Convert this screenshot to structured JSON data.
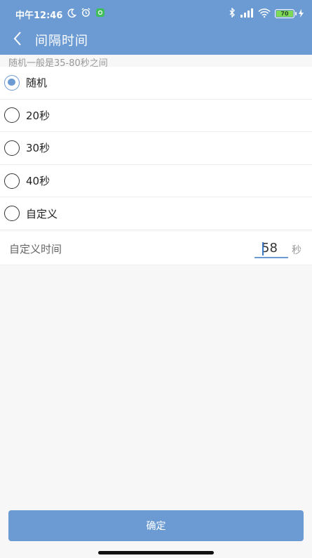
{
  "status_bar": {
    "time": "中午12:46",
    "battery_level": "70"
  },
  "nav": {
    "title": "间隔时间"
  },
  "hint": "随机一般是35-80秒之间",
  "options": [
    {
      "label": "随机",
      "selected": true
    },
    {
      "label": "20秒",
      "selected": false
    },
    {
      "label": "30秒",
      "selected": false
    },
    {
      "label": "40秒",
      "selected": false
    },
    {
      "label": "自定义",
      "selected": false
    }
  ],
  "custom": {
    "label": "自定义时间",
    "value": "58",
    "unit": "秒"
  },
  "confirm_label": "确定",
  "colors": {
    "accent": "#6b9bd2",
    "battery": "#7ed957"
  }
}
